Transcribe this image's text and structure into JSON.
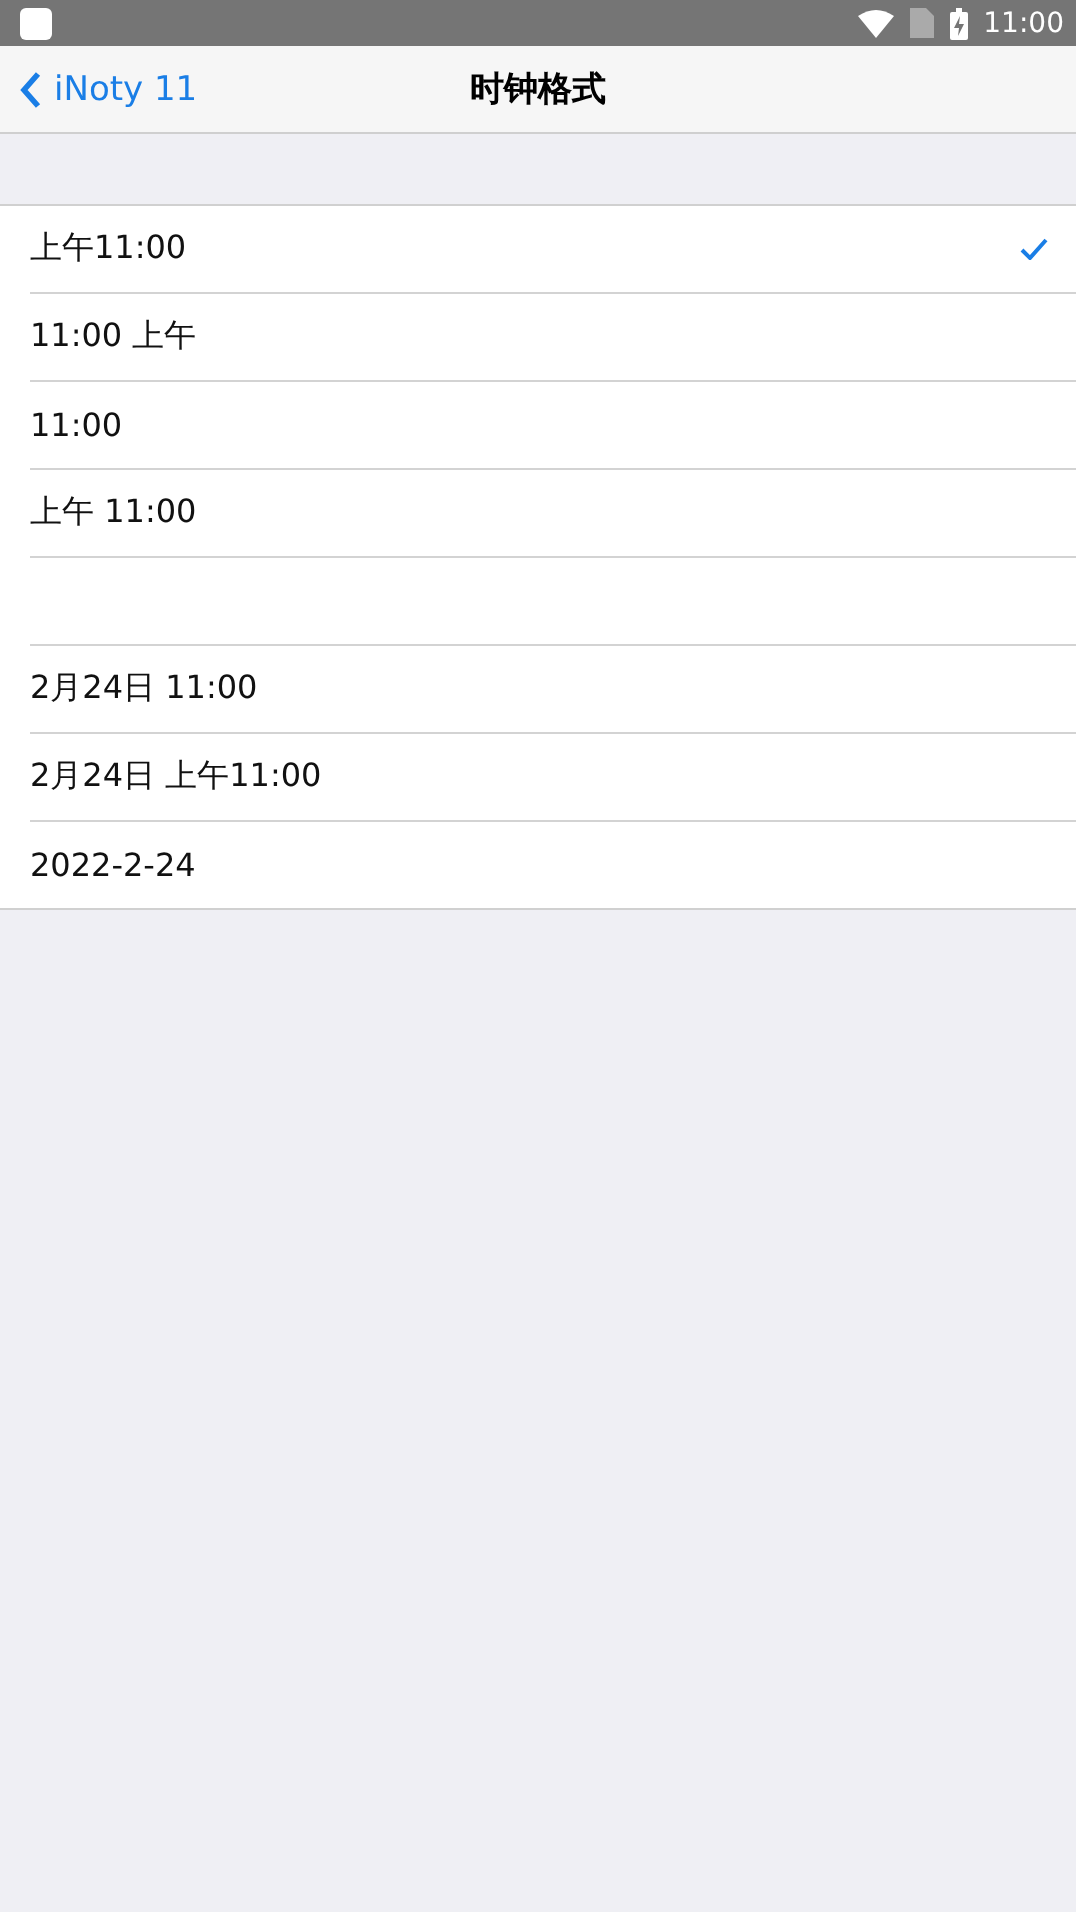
{
  "status_bar": {
    "time": "11:00"
  },
  "nav": {
    "back": "iNoty 11",
    "title": "时钟格式"
  },
  "rows": [
    {
      "kind": "option",
      "label": "上午11:00",
      "selected": true
    },
    {
      "kind": "option",
      "label": "11:00 上午",
      "selected": false
    },
    {
      "kind": "option",
      "label": "11:00",
      "selected": false
    },
    {
      "kind": "option",
      "label": "上午 11:00",
      "selected": false
    },
    {
      "kind": "blank"
    },
    {
      "kind": "option",
      "label": "2月24日 11:00",
      "selected": false
    },
    {
      "kind": "option",
      "label": "2月24日 上午11:00",
      "selected": false
    },
    {
      "kind": "option",
      "label": "2022-2-24",
      "selected": false
    }
  ]
}
